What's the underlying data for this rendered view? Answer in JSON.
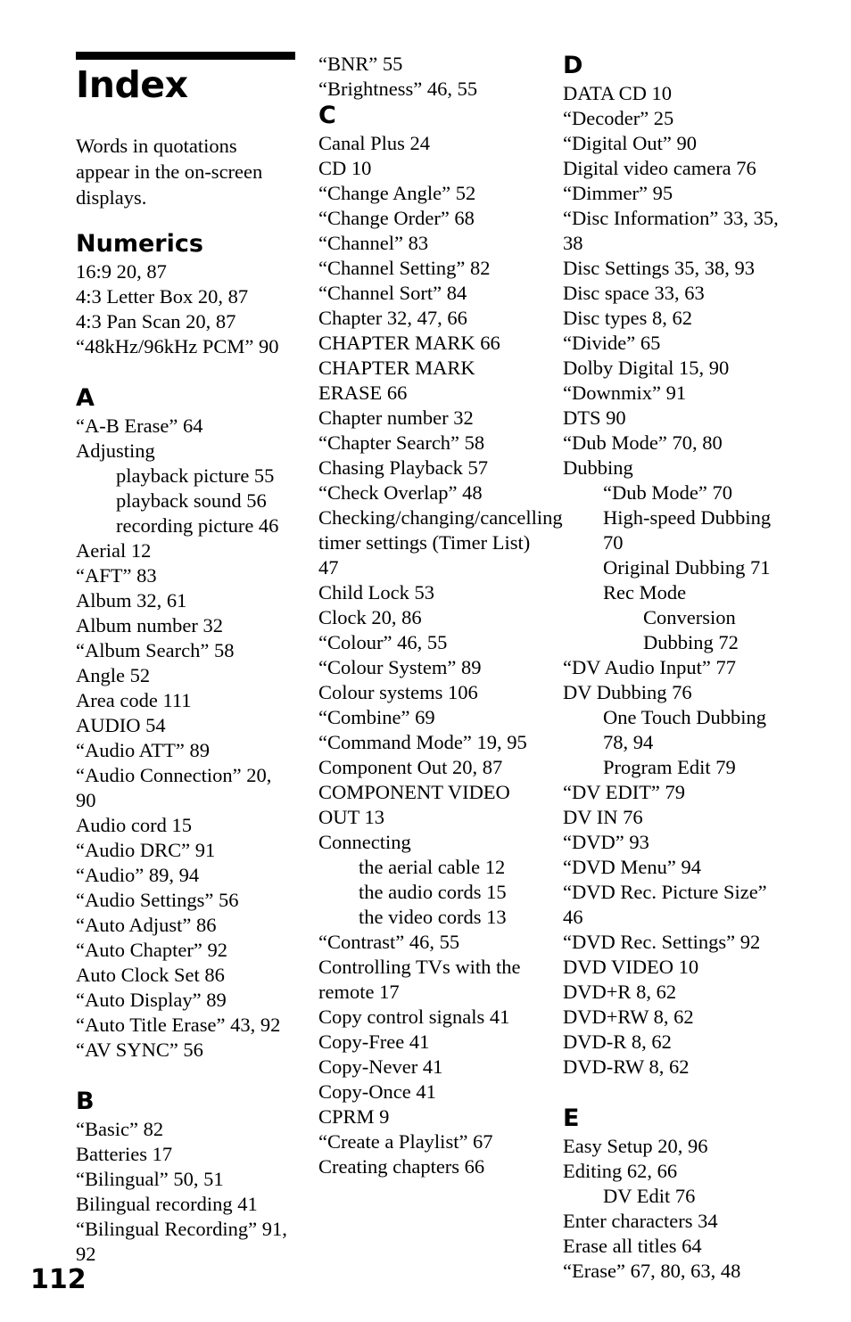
{
  "page": {
    "title": "Index",
    "folio": "112",
    "intro": "Words in quotations appear in the on-screen displays."
  },
  "columns": [
    {
      "id": "column-1",
      "sections": [
        {
          "letter": "Numerics",
          "entries": [
            {
              "text": "16:9 20, 87",
              "level": 0
            },
            {
              "text": "4:3 Letter Box 20, 87",
              "level": 0
            },
            {
              "text": "4:3 Pan Scan 20, 87",
              "level": 0
            },
            {
              "text": "“48kHz/96kHz PCM” 90",
              "level": 0
            }
          ]
        },
        {
          "letter": "A",
          "entries": [
            {
              "text": "“A-B Erase” 64",
              "level": 0
            },
            {
              "text": "Adjusting",
              "level": 0
            },
            {
              "text": "playback picture 55",
              "level": 1
            },
            {
              "text": "playback sound 56",
              "level": 1
            },
            {
              "text": "recording picture 46",
              "level": 1
            },
            {
              "text": "Aerial 12",
              "level": 0
            },
            {
              "text": "“AFT” 83",
              "level": 0
            },
            {
              "text": "Album 32, 61",
              "level": 0
            },
            {
              "text": "Album number 32",
              "level": 0
            },
            {
              "text": "“Album Search” 58",
              "level": 0
            },
            {
              "text": "Angle 52",
              "level": 0
            },
            {
              "text": "Area code 111",
              "level": 0
            },
            {
              "text": "AUDIO 54",
              "level": 0
            },
            {
              "text": "“Audio ATT” 89",
              "level": 0
            },
            {
              "text": "“Audio Connection” 20, 90",
              "level": 0
            },
            {
              "text": "Audio cord 15",
              "level": 0
            },
            {
              "text": "“Audio DRC” 91",
              "level": 0
            },
            {
              "text": "“Audio” 89, 94",
              "level": 0
            },
            {
              "text": "“Audio Settings” 56",
              "level": 0
            },
            {
              "text": "“Auto Adjust” 86",
              "level": 0
            },
            {
              "text": "“Auto Chapter” 92",
              "level": 0
            },
            {
              "text": "Auto Clock Set 86",
              "level": 0
            },
            {
              "text": "“Auto Display” 89",
              "level": 0
            },
            {
              "text": "“Auto Title Erase” 43, 92",
              "level": 0
            },
            {
              "text": "“AV SYNC” 56",
              "level": 0
            }
          ]
        },
        {
          "letter": "B",
          "entries": [
            {
              "text": "“Basic” 82",
              "level": 0
            },
            {
              "text": "Batteries 17",
              "level": 0
            },
            {
              "text": "“Bilingual” 50, 51",
              "level": 0
            },
            {
              "text": "Bilingual recording 41",
              "level": 0
            },
            {
              "text": "“Bilingual Recording” 91, 92",
              "level": 0
            }
          ]
        }
      ]
    },
    {
      "id": "column-2",
      "sections": [
        {
          "letter": "",
          "entries": [
            {
              "text": "“BNR” 55",
              "level": 0
            },
            {
              "text": "“Brightness” 46, 55",
              "level": 0
            }
          ]
        },
        {
          "letter": "C",
          "entries": [
            {
              "text": "Canal Plus 24",
              "level": 0
            },
            {
              "text": "CD 10",
              "level": 0
            },
            {
              "text": "“Change Angle” 52",
              "level": 0
            },
            {
              "text": "“Change Order” 68",
              "level": 0
            },
            {
              "text": "“Channel” 83",
              "level": 0
            },
            {
              "text": "“Channel Setting” 82",
              "level": 0
            },
            {
              "text": "“Channel Sort” 84",
              "level": 0
            },
            {
              "text": "Chapter 32, 47, 66",
              "level": 0
            },
            {
              "text": "CHAPTER MARK 66",
              "level": 0
            },
            {
              "text": "CHAPTER MARK ERASE 66",
              "level": 0
            },
            {
              "text": "Chapter number 32",
              "level": 0
            },
            {
              "text": "“Chapter Search” 58",
              "level": 0
            },
            {
              "text": "Chasing Playback 57",
              "level": 0
            },
            {
              "text": "“Check Overlap” 48",
              "level": 0
            },
            {
              "text": "Checking/changing/cancelling timer settings (Timer List) 47",
              "level": 0
            },
            {
              "text": "Child Lock 53",
              "level": 0
            },
            {
              "text": "Clock 20, 86",
              "level": 0
            },
            {
              "text": "“Colour” 46, 55",
              "level": 0
            },
            {
              "text": "“Colour System” 89",
              "level": 0
            },
            {
              "text": "Colour systems 106",
              "level": 0
            },
            {
              "text": "“Combine” 69",
              "level": 0
            },
            {
              "text": "“Command Mode” 19, 95",
              "level": 0
            },
            {
              "text": "Component Out 20, 87",
              "level": 0
            },
            {
              "text": "COMPONENT VIDEO OUT 13",
              "level": 0
            },
            {
              "text": "Connecting",
              "level": 0
            },
            {
              "text": "the aerial cable 12",
              "level": 1
            },
            {
              "text": "the audio cords 15",
              "level": 1
            },
            {
              "text": "the video cords 13",
              "level": 1
            },
            {
              "text": "“Contrast” 46, 55",
              "level": 0
            },
            {
              "text": "Controlling TVs with the remote 17",
              "level": 0
            },
            {
              "text": "Copy control signals 41",
              "level": 0
            },
            {
              "text": "Copy-Free 41",
              "level": 0
            },
            {
              "text": "Copy-Never 41",
              "level": 0
            },
            {
              "text": "Copy-Once 41",
              "level": 0
            },
            {
              "text": "CPRM 9",
              "level": 0
            },
            {
              "text": "“Create a Playlist” 67",
              "level": 0
            },
            {
              "text": "Creating chapters 66",
              "level": 0
            }
          ]
        }
      ]
    },
    {
      "id": "column-3",
      "sections": [
        {
          "letter": "D",
          "entries": [
            {
              "text": "DATA CD 10",
              "level": 0
            },
            {
              "text": "“Decoder” 25",
              "level": 0
            },
            {
              "text": "“Digital Out” 90",
              "level": 0
            },
            {
              "text": "Digital video camera 76",
              "level": 0
            },
            {
              "text": "“Dimmer” 95",
              "level": 0
            },
            {
              "text": "“Disc Information” 33, 35, 38",
              "level": 0
            },
            {
              "text": "Disc Settings 35, 38, 93",
              "level": 0
            },
            {
              "text": "Disc space 33, 63",
              "level": 0
            },
            {
              "text": "Disc types 8, 62",
              "level": 0
            },
            {
              "text": "“Divide” 65",
              "level": 0
            },
            {
              "text": "Dolby Digital 15, 90",
              "level": 0
            },
            {
              "text": "“Downmix” 91",
              "level": 0
            },
            {
              "text": "DTS 90",
              "level": 0
            },
            {
              "text": "“Dub Mode” 70, 80",
              "level": 0
            },
            {
              "text": "Dubbing",
              "level": 0
            },
            {
              "text": "“Dub Mode” 70",
              "level": 1
            },
            {
              "text": "High-speed Dubbing 70",
              "level": 1
            },
            {
              "text": "Original Dubbing 71",
              "level": 1
            },
            {
              "text": "Rec Mode",
              "level": 1
            },
            {
              "text": "Conversion Dubbing 72",
              "level": 2
            },
            {
              "text": "“DV Audio Input” 77",
              "level": 0
            },
            {
              "text": "DV Dubbing 76",
              "level": 0
            },
            {
              "text": "One Touch Dubbing 78, 94",
              "level": 1
            },
            {
              "text": "Program Edit 79",
              "level": 1
            },
            {
              "text": "“DV EDIT” 79",
              "level": 0
            },
            {
              "text": "DV IN 76",
              "level": 0
            },
            {
              "text": "“DVD” 93",
              "level": 0
            },
            {
              "text": "“DVD Menu” 94",
              "level": 0
            },
            {
              "text": "“DVD Rec. Picture Size” 46",
              "level": 0
            },
            {
              "text": "“DVD Rec. Settings” 92",
              "level": 0
            },
            {
              "text": "DVD VIDEO 10",
              "level": 0
            },
            {
              "text": "DVD+R 8, 62",
              "level": 0
            },
            {
              "text": "DVD+RW 8, 62",
              "level": 0
            },
            {
              "text": "DVD-R 8, 62",
              "level": 0
            },
            {
              "text": "DVD-RW 8, 62",
              "level": 0
            }
          ]
        },
        {
          "letter": "E",
          "entries": [
            {
              "text": "Easy Setup 20, 96",
              "level": 0
            },
            {
              "text": "Editing 62, 66",
              "level": 0
            },
            {
              "text": "DV Edit 76",
              "level": 1
            },
            {
              "text": "Enter characters 34",
              "level": 0
            },
            {
              "text": "Erase all titles 64",
              "level": 0
            },
            {
              "text": "“Erase” 67, 80, 63, 48",
              "level": 0
            }
          ]
        }
      ]
    }
  ]
}
